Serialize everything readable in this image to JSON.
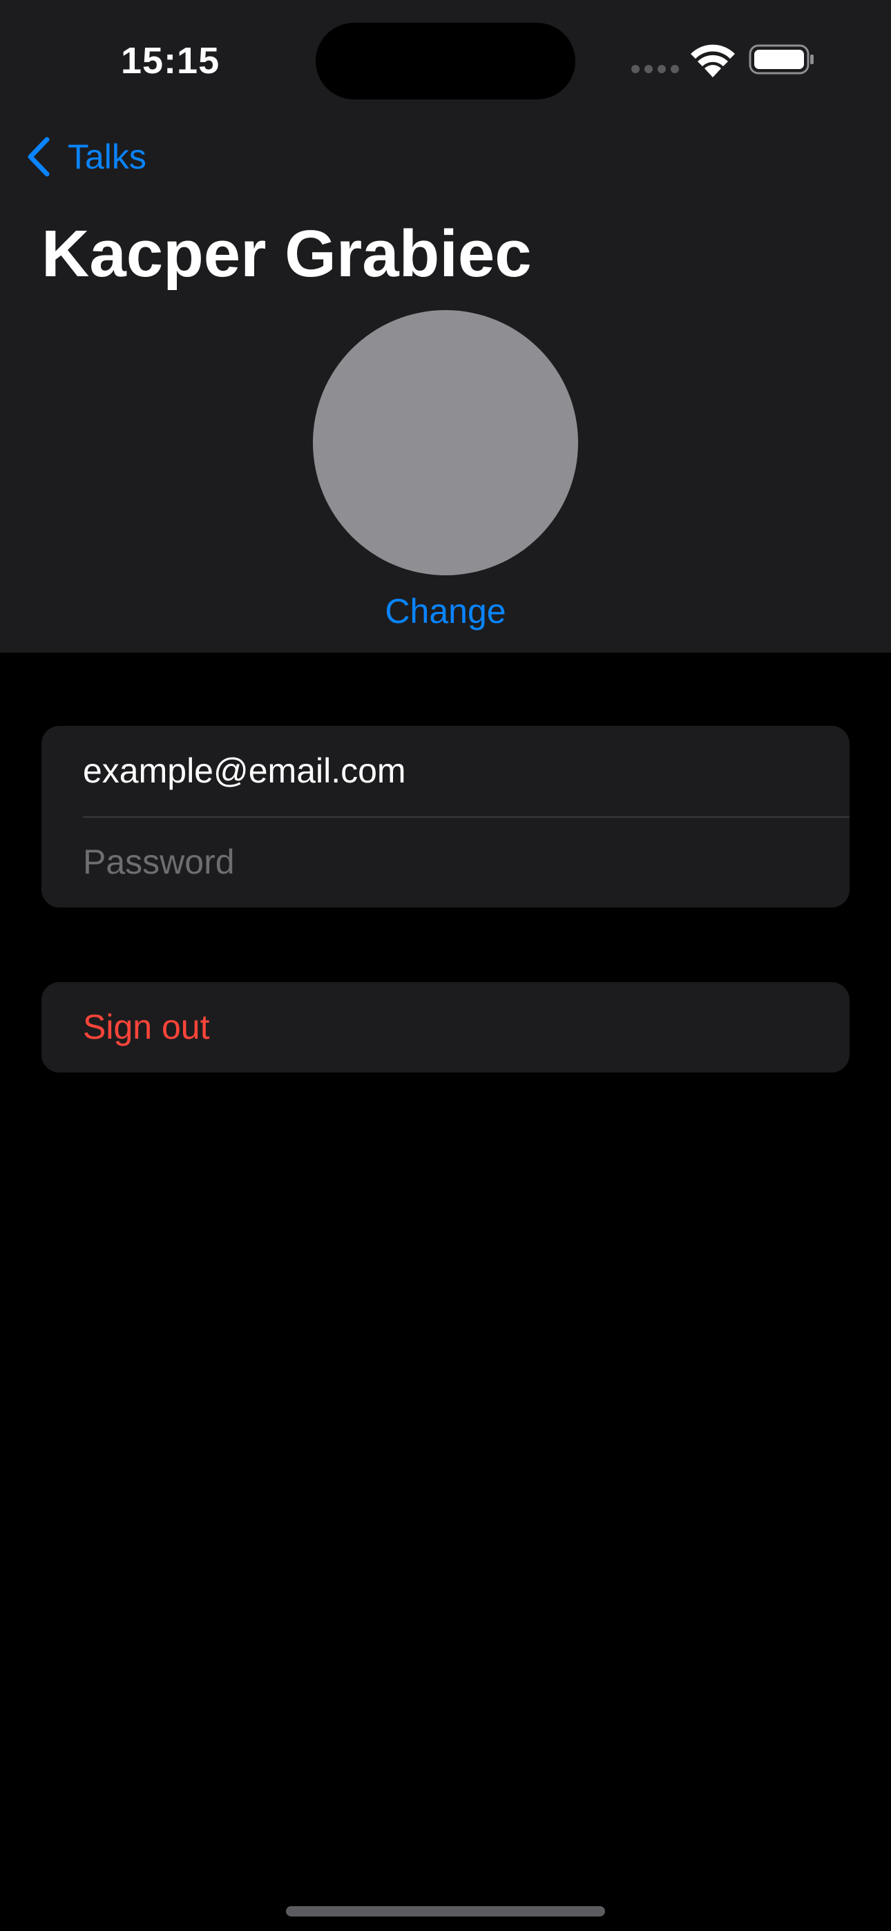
{
  "status_bar": {
    "time": "15:15",
    "icons": [
      "cellular-signal-icon",
      "wifi-icon",
      "battery-icon"
    ]
  },
  "nav": {
    "back_label": "Talks",
    "back_icon": "chevron-left-icon",
    "title": "Kacper Grabiec"
  },
  "profile": {
    "avatar_color": "#8e8e93",
    "change_label": "Change"
  },
  "form": {
    "email_value": "example@email.com",
    "password_placeholder": "Password"
  },
  "actions": {
    "sign_out_label": "Sign out"
  },
  "colors": {
    "accent": "#0a84ff",
    "destructive": "#ff453a",
    "background": "#000000",
    "grouped_background": "#1c1c1e",
    "placeholder": "#6d6d72"
  }
}
